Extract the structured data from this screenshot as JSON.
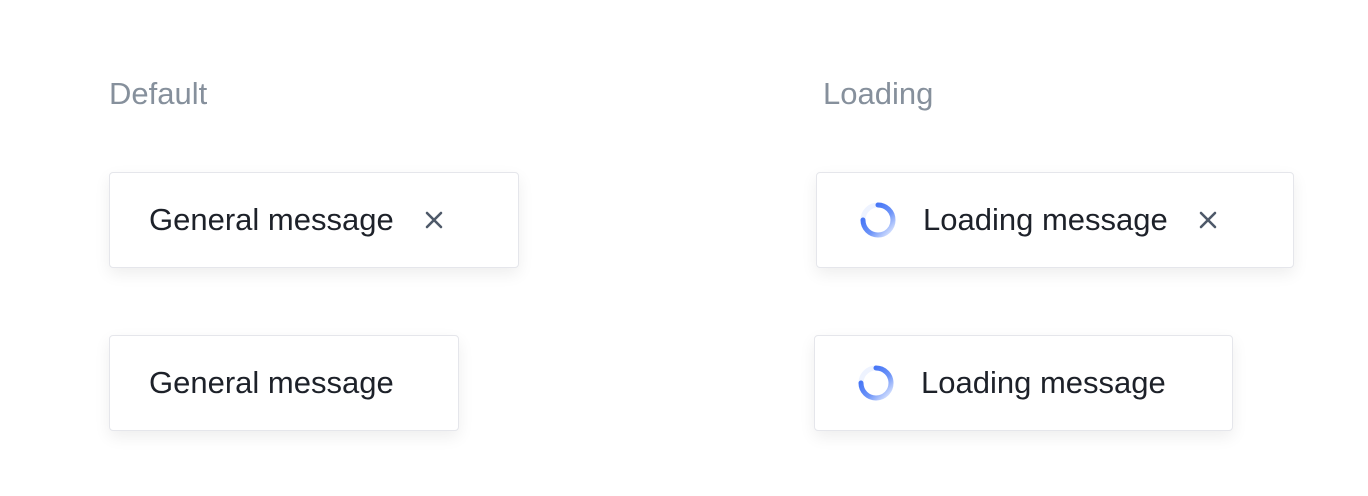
{
  "sections": {
    "default_label": "Default",
    "loading_label": "Loading"
  },
  "messages": {
    "default_closable": "General message",
    "default_plain": "General message",
    "loading_closable": "Loading message",
    "loading_plain": "Loading message"
  },
  "icons": {
    "close": "close-icon",
    "loading": "loading-spinner-icon"
  },
  "colors": {
    "text": "#1d2129",
    "label": "#86909c",
    "accent": "#3b6ff5",
    "border": "#e5e6eb"
  }
}
